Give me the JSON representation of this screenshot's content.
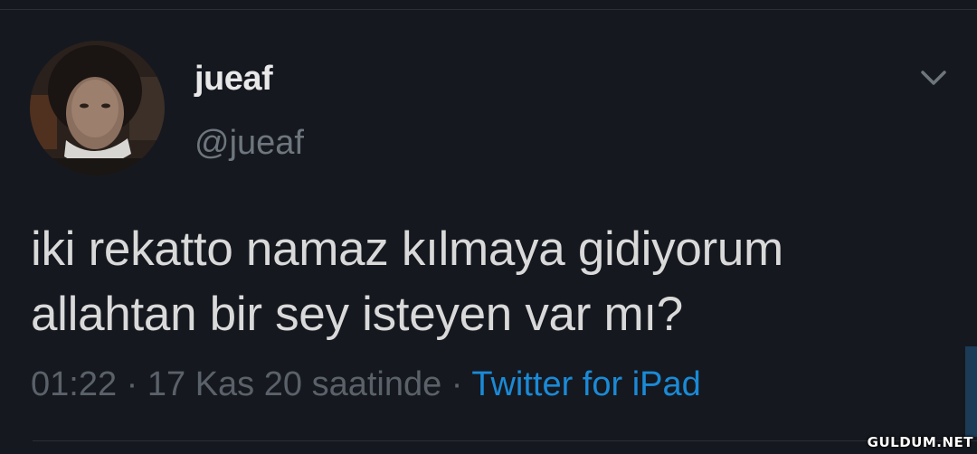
{
  "tweet": {
    "display_name": "jueaf",
    "handle": "@jueaf",
    "text_line1": "iki rekatto namaz kılmaya gidiyorum",
    "text_line2": "allahtan bir sey isteyen var mı?",
    "time": "01:22",
    "separator": " · ",
    "date": "17 Kas 20 saatinde",
    "source": "Twitter for iPad"
  },
  "icons": {
    "avatar": "profile-photo",
    "menu": "chevron-down-icon"
  },
  "watermark": "GULDUM.NET",
  "colors": {
    "background": "#15181f",
    "text": "#d9d9d9",
    "muted": "#5b6169",
    "link": "#1b8ad6"
  }
}
